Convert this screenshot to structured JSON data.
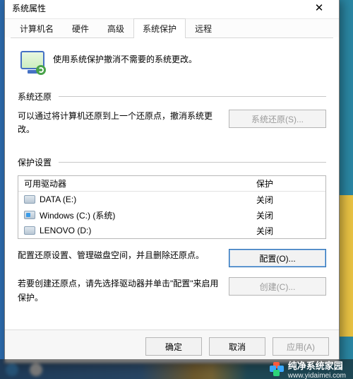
{
  "window": {
    "title": "系统属性",
    "close_glyph": "✕"
  },
  "tabs": [
    {
      "label": "计算机名"
    },
    {
      "label": "硬件"
    },
    {
      "label": "高级"
    },
    {
      "label": "系统保护",
      "active": true
    },
    {
      "label": "远程"
    }
  ],
  "intro_text": "使用系统保护撤消不需要的系统更改。",
  "restore": {
    "heading": "系统还原",
    "desc": "可以通过将计算机还原到上一个还原点，撤消系统更改。",
    "button": "系统还原(S)..."
  },
  "protection": {
    "heading": "保护设置",
    "col_drive": "可用驱动器",
    "col_status": "保护",
    "drives": [
      {
        "name": "DATA (E:)",
        "status": "关闭",
        "kind": "disk"
      },
      {
        "name": "Windows (C:) (系统)",
        "status": "关闭",
        "kind": "win"
      },
      {
        "name": "LENOVO (D:)",
        "status": "关闭",
        "kind": "disk"
      }
    ],
    "configure_desc": "配置还原设置、管理磁盘空间，并且删除还原点。",
    "configure_button": "配置(O)...",
    "create_desc": "若要创建还原点，请先选择驱动器并单击\"配置\"来启用保护。",
    "create_button": "创建(C)..."
  },
  "footer": {
    "ok": "确定",
    "cancel": "取消",
    "apply": "应用(A)"
  },
  "watermark": {
    "brand": "纯净系统家园",
    "url": "www.yidaimei.com"
  }
}
